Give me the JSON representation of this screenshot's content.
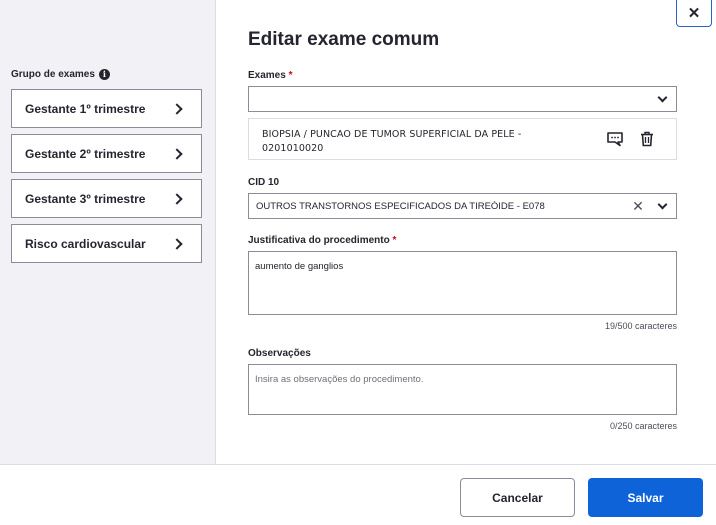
{
  "sidebar": {
    "group_title": "Grupo de exames",
    "items": [
      {
        "label": "Gestante 1º trimestre"
      },
      {
        "label": "Gestante 2º trimestre"
      },
      {
        "label": "Gestante 3º trimestre"
      },
      {
        "label": "Risco cardiovascular"
      }
    ]
  },
  "modal": {
    "close_label": "✕",
    "title": "Editar exame comum"
  },
  "form": {
    "exames": {
      "label": "Exames",
      "required_mark": "*",
      "value": "",
      "selected_item": {
        "line1": "BIOPSIA / PUNCAO DE TUMOR SUPERFICIAL DA PELE -",
        "line2": "0201010020"
      }
    },
    "cid10": {
      "label": "CID 10",
      "value": "OUTROS TRANSTORNOS ESPECIFICADOS DA TIREÓIDE - E078"
    },
    "justificativa": {
      "label": "Justificativa do procedimento",
      "required_mark": "*",
      "value": "aumento de ganglios",
      "counter": "19/500 caracteres"
    },
    "observacoes": {
      "label": "Observações",
      "placeholder": "Insira as observações do procedimento.",
      "counter": "0/250 caracteres"
    }
  },
  "footer": {
    "cancel_label": "Cancelar",
    "save_label": "Salvar"
  },
  "colors": {
    "accent": "#0e63d9",
    "required": "#d0021b",
    "sidebar_bg": "#f2f2f6"
  }
}
